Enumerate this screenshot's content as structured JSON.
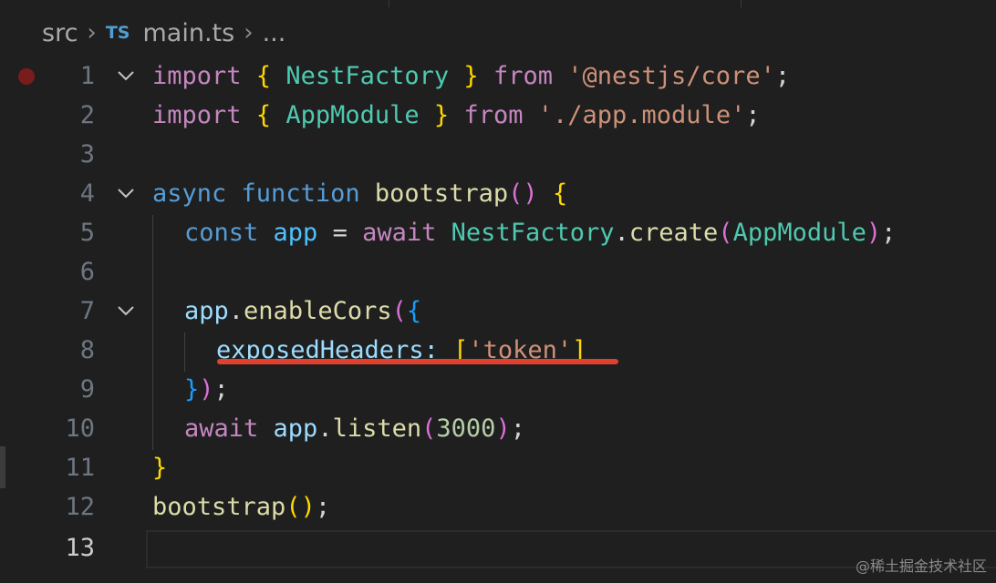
{
  "breadcrumb": {
    "folder": "src",
    "file_icon": "TS",
    "file": "main.ts",
    "more": "..."
  },
  "editor": {
    "active_line": 13,
    "breakpoint_line": 1,
    "lines": [
      {
        "n": "1",
        "fold": true
      },
      {
        "n": "2",
        "fold": false
      },
      {
        "n": "3",
        "fold": false
      },
      {
        "n": "4",
        "fold": true
      },
      {
        "n": "5",
        "fold": false
      },
      {
        "n": "6",
        "fold": false
      },
      {
        "n": "7",
        "fold": true
      },
      {
        "n": "8",
        "fold": false
      },
      {
        "n": "9",
        "fold": false
      },
      {
        "n": "10",
        "fold": false
      },
      {
        "n": "11",
        "fold": false
      },
      {
        "n": "12",
        "fold": false
      },
      {
        "n": "13",
        "fold": false
      }
    ],
    "tokens": {
      "import": "import",
      "lbrace": "{",
      "rbrace": "}",
      "NestFactory": "NestFactory",
      "from": "from",
      "core_str": "'@nestjs/core'",
      "semi": ";",
      "AppModule": "AppModule",
      "module_str": "'./app.module'",
      "async": "async",
      "function": "function",
      "bootstrap": "bootstrap",
      "parens": "()",
      "const": "const",
      "app": "app",
      "eq": "=",
      "await": "await",
      "dot": ".",
      "create": "create",
      "lparen": "(",
      "rparen": ")",
      "enableCors": "enableCors",
      "exposedHeaders": "exposedHeaders",
      "colon": ":",
      "lbracket": "[",
      "rbracket": "]",
      "token_str": "'token'",
      "listen": "listen",
      "port": "3000"
    }
  },
  "watermark": "@稀土掘金技术社区",
  "colors": {
    "background": "#1f1f1f",
    "keyword": "#c586c0",
    "storage": "#569cd6",
    "class": "#4ec9b0",
    "variable": "#9cdcfe",
    "function": "#dcdcaa",
    "string": "#ce9178",
    "number": "#b5cea8",
    "annotation_underline": "#e0402e"
  }
}
